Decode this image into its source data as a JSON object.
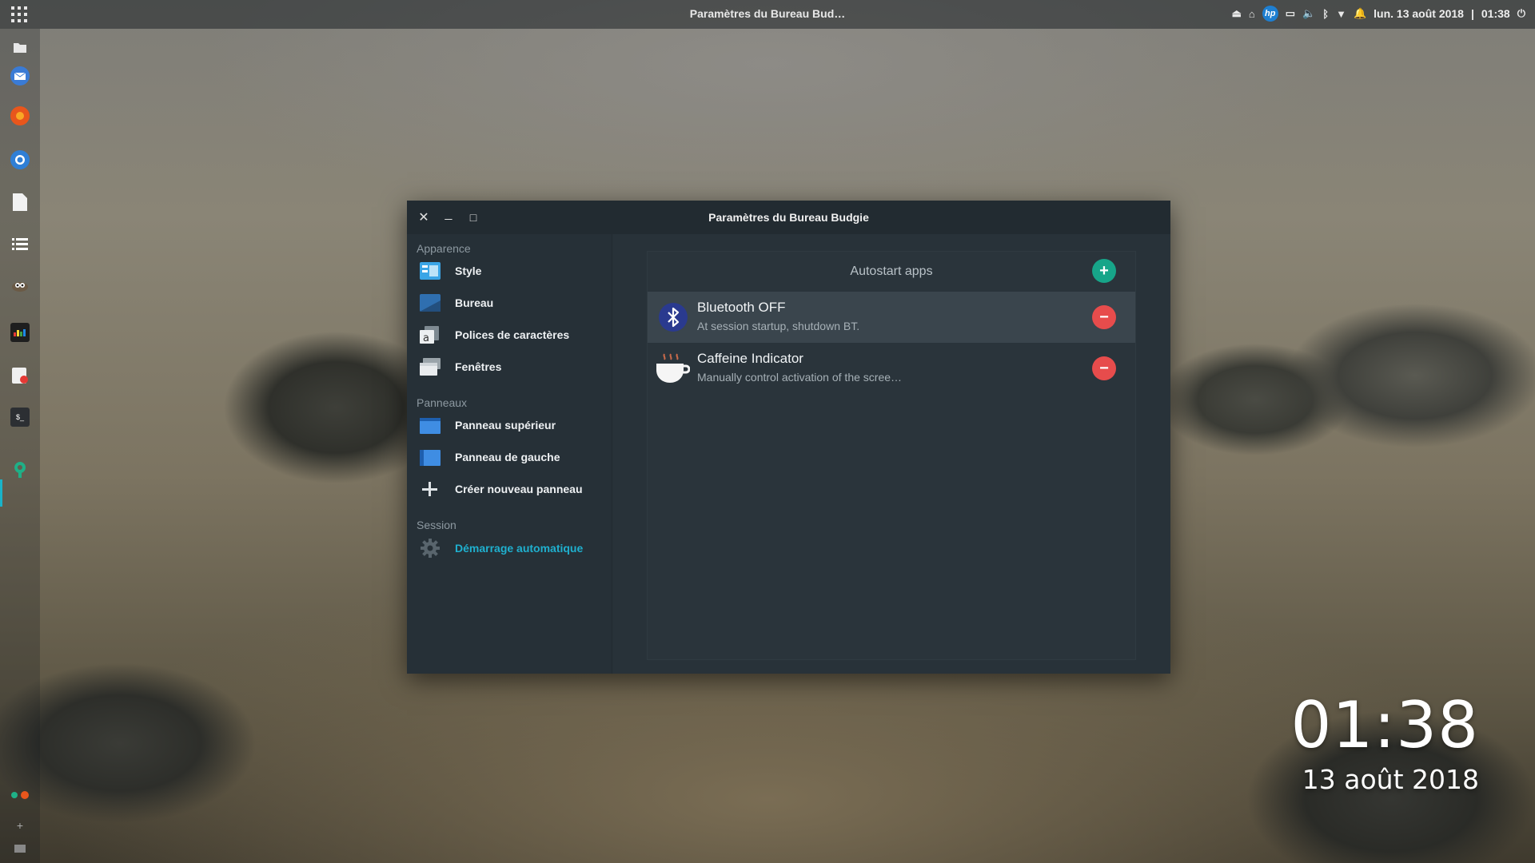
{
  "topbar": {
    "title": "Paramètres du Bureau Bud…",
    "datetime": "lun. 13 août 2018",
    "separator": "|",
    "time": "01:38",
    "tray_icons": [
      "eject-icon",
      "home-icon",
      "hp-icon",
      "battery-icon",
      "volume-icon",
      "bluetooth-icon",
      "wifi-icon",
      "notification-bell-icon",
      "power-icon"
    ]
  },
  "dock": {
    "apps": [
      "files-icon",
      "thunderbird-icon",
      "firefox-icon",
      "chromium-icon",
      "text-editor-icon",
      "task-list-icon",
      "gimp-icon",
      "system-monitor-icon",
      "drawing-icon",
      "terminal-icon",
      "budgie-settings-icon"
    ],
    "bottom_add": "+"
  },
  "window": {
    "title": "Paramètres du Bureau Budgie",
    "close": "✕",
    "minimize": "_",
    "maximize": "□",
    "sidebar": {
      "sections": [
        {
          "label": "Apparence"
        },
        {
          "label": "Panneaux"
        },
        {
          "label": "Session"
        }
      ],
      "items": [
        {
          "label": "Style",
          "icon": "style-icon"
        },
        {
          "label": "Bureau",
          "icon": "desktop-icon"
        },
        {
          "label": "Polices de caractères",
          "icon": "fonts-icon"
        },
        {
          "label": "Fenêtres",
          "icon": "windows-icon"
        },
        {
          "label": "Panneau supérieur",
          "icon": "top-panel-icon"
        },
        {
          "label": "Panneau de gauche",
          "icon": "left-panel-icon"
        },
        {
          "label": "Créer nouveau panneau",
          "icon": "plus-icon"
        },
        {
          "label": "Démarrage automatique",
          "icon": "gear-icon",
          "selected": true
        }
      ]
    },
    "autostart": {
      "title": "Autostart apps",
      "add_symbol": "+",
      "remove_symbol": "−",
      "apps": [
        {
          "name": "Bluetooth OFF",
          "description": "At session startup, shutdown BT.",
          "icon": "bluetooth-icon"
        },
        {
          "name": "Caffeine Indicator",
          "description": "Manually control activation of the scree…",
          "icon": "coffee-cup-icon"
        }
      ]
    }
  },
  "desklet": {
    "time": "01:38",
    "date": "13 août 2018"
  },
  "colors": {
    "accent": "#1fb0cf",
    "add_button": "#17a589",
    "remove_button": "#e74c4c",
    "window_bg": "#283239"
  }
}
